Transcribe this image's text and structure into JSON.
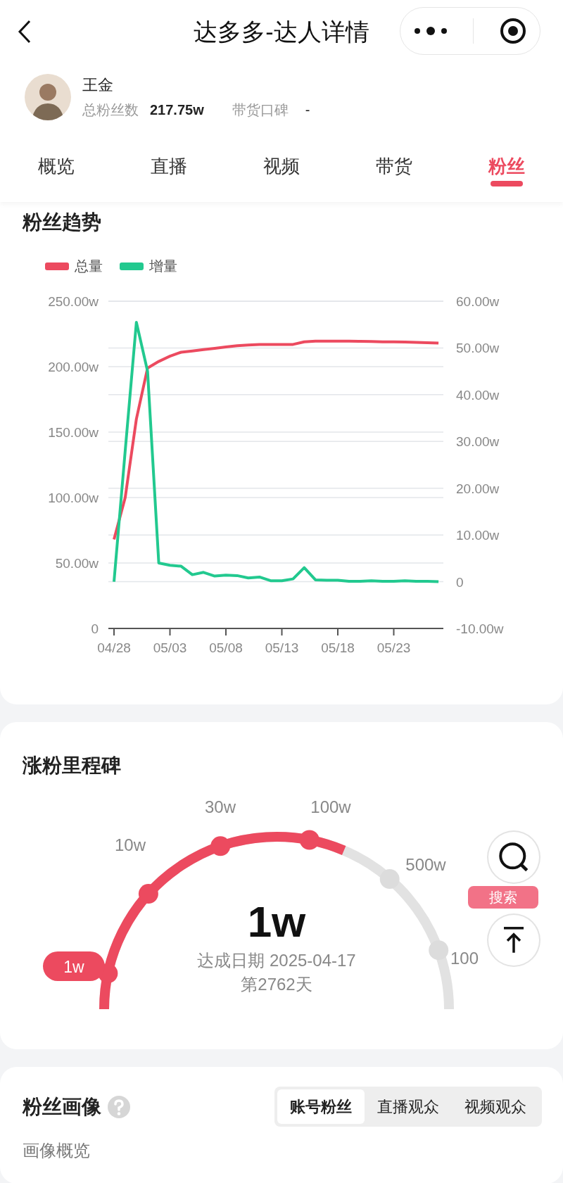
{
  "nav": {
    "title": "达多多-达人详情"
  },
  "profile": {
    "name": "王金",
    "fans_label": "总粉丝数",
    "fans_value": "217.75w",
    "reputation_label": "带货口碑",
    "reputation_value": "-"
  },
  "tabs": [
    {
      "label": "概览",
      "selected": false
    },
    {
      "label": "直播",
      "selected": false
    },
    {
      "label": "视频",
      "selected": false
    },
    {
      "label": "带货",
      "selected": false
    },
    {
      "label": "粉丝",
      "selected": true
    }
  ],
  "trend": {
    "title": "粉丝趋势",
    "chart_data": {
      "type": "line",
      "categories": [
        "04/28",
        null,
        null,
        null,
        null,
        "05/03",
        null,
        null,
        null,
        null,
        "05/08",
        null,
        null,
        null,
        null,
        "05/13",
        null,
        null,
        null,
        null,
        "05/18",
        null,
        null,
        null,
        null,
        "05/23",
        null,
        null,
        null,
        null
      ],
      "grid": true,
      "ylim": [
        0,
        250
      ],
      "yticks": [
        {
          "value": 0,
          "label": "0"
        },
        {
          "value": 50,
          "label": "50.00w"
        },
        {
          "value": 100,
          "label": "100.00w"
        },
        {
          "value": 150,
          "label": "150.00w"
        },
        {
          "value": 200,
          "label": "200.00w"
        },
        {
          "value": 250,
          "label": "250.00w"
        }
      ],
      "y2lim": [
        -10,
        60
      ],
      "y2ticks": [
        {
          "value": -10,
          "label": "-10.00w"
        },
        {
          "value": 0,
          "label": "0"
        },
        {
          "value": 10,
          "label": "10.00w"
        },
        {
          "value": 20,
          "label": "20.00w"
        },
        {
          "value": 30,
          "label": "30.00w"
        },
        {
          "value": 40,
          "label": "40.00w"
        },
        {
          "value": 50,
          "label": "50.00w"
        },
        {
          "value": 60,
          "label": "60.00w"
        }
      ],
      "series": [
        {
          "name": "总量",
          "color": "#ec4a5f",
          "values": [
            68,
            100,
            160,
            199,
            204,
            208,
            211,
            212,
            213,
            214,
            215,
            216,
            216.5,
            217,
            217,
            217,
            217,
            219,
            219.5,
            219.5,
            219.5,
            219.5,
            219.3,
            219.2,
            219,
            219,
            218.8,
            218.5,
            218.3,
            218
          ]
        },
        {
          "name": "增量",
          "color": "#22c98f",
          "axis": "y2",
          "values": [
            0,
            28,
            55.5,
            45,
            4,
            3.5,
            3.3,
            1.5,
            2,
            1.2,
            1.4,
            1.3,
            0.8,
            1,
            0.2,
            0.2,
            0.6,
            3,
            0.4,
            0.3,
            0.3,
            0.1,
            0.1,
            0.2,
            0.1,
            0.1,
            0.2,
            0.1,
            0.1,
            0
          ]
        }
      ]
    }
  },
  "milestones": {
    "title": "涨粉里程碑",
    "items": [
      {
        "label": "1w",
        "reached": true,
        "selected": true
      },
      {
        "label": "10w",
        "reached": true,
        "selected": false
      },
      {
        "label": "30w",
        "reached": true,
        "selected": false
      },
      {
        "label": "100w",
        "reached": true,
        "selected": false
      },
      {
        "label": "500w",
        "reached": false,
        "selected": false
      },
      {
        "label": "100",
        "reached": false,
        "selected": false
      }
    ],
    "current": "1w",
    "date_text": "达成日期 2025-04-17",
    "day_text": "第2762天"
  },
  "float_buttons": {
    "search_label": "搜索"
  },
  "portrait": {
    "title": "粉丝画像",
    "segments": [
      {
        "label": "账号粉丝",
        "selected": true
      },
      {
        "label": "直播观众",
        "selected": false
      },
      {
        "label": "视频观众",
        "selected": false
      }
    ],
    "subtitle": "画像概览"
  }
}
